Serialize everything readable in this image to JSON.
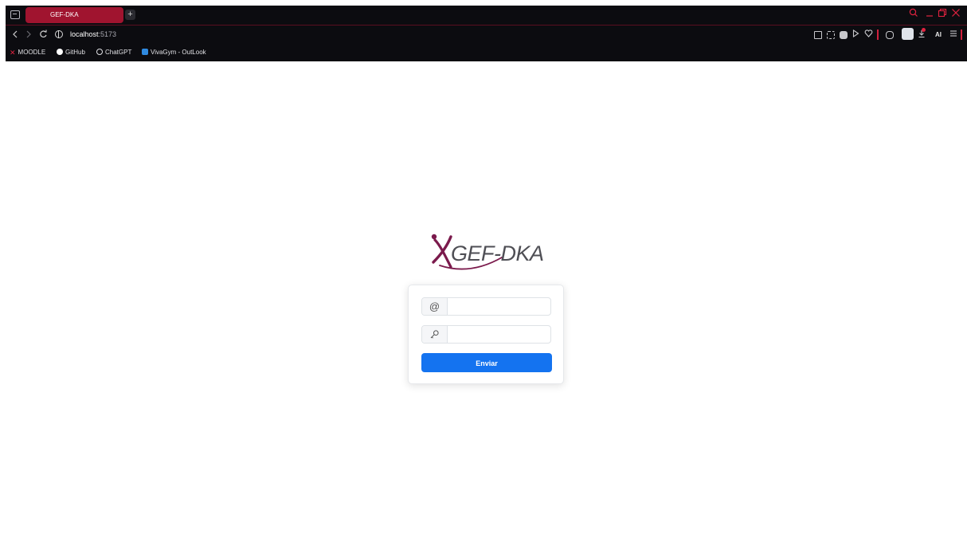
{
  "browser": {
    "tab": {
      "title": "GEF-DKA"
    },
    "new_tab_label": "+",
    "address": {
      "host": "localhost",
      "port": ":5173"
    },
    "ai_label": "AI",
    "accent_color": "#a0142f",
    "icons": [
      "workspaces-icon",
      "search-icon",
      "minimize-icon",
      "restore-icon",
      "close-icon",
      "back-icon",
      "forward-icon",
      "reload-icon",
      "globe-icon",
      "pin-icon",
      "screenshot-icon",
      "pocket-icon",
      "play-icon",
      "heart-icon",
      "extensions-icon",
      "download-icon",
      "menu-icon"
    ]
  },
  "bookmarks": [
    {
      "label": "MOODLE",
      "icon": "moodle-icon"
    },
    {
      "label": "GitHub",
      "icon": "github-icon"
    },
    {
      "label": "ChatGPT",
      "icon": "chatgpt-icon"
    },
    {
      "label": "VivaGym - OutLook",
      "icon": "outlook-icon"
    }
  ],
  "login": {
    "logo_text": "GEF-DKA",
    "email": {
      "icon": "at-icon",
      "value": ""
    },
    "password": {
      "icon": "key-icon",
      "value": ""
    },
    "submit_label": "Enviar",
    "button_color": "#1473f0"
  }
}
